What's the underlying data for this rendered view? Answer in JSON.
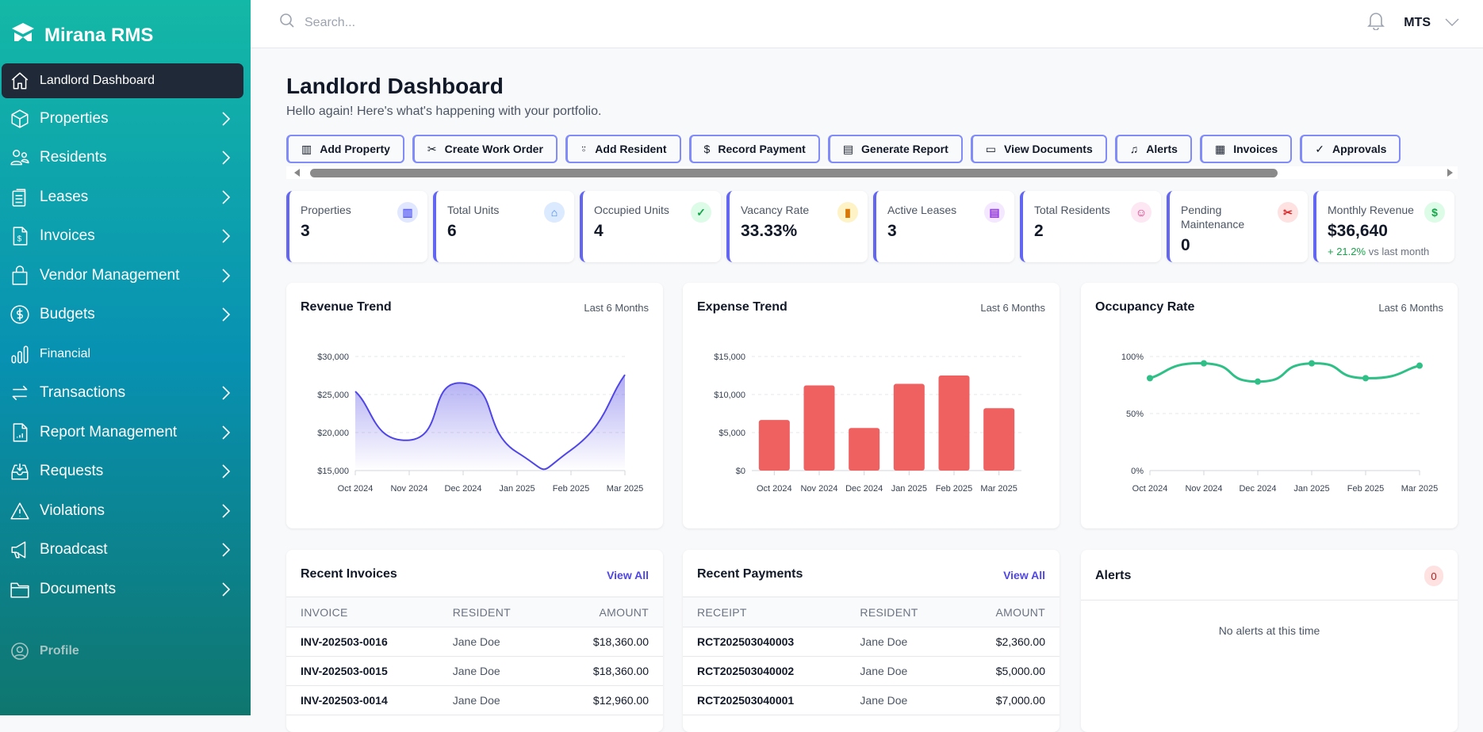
{
  "app": {
    "name": "Mirana RMS"
  },
  "sidebar": {
    "items": [
      {
        "label": "Landlord Dashboard",
        "icon": "home-icon",
        "active": true
      },
      {
        "label": "Properties",
        "icon": "cube-icon"
      },
      {
        "label": "Residents",
        "icon": "users-icon"
      },
      {
        "label": "Leases",
        "icon": "clipboard-icon"
      },
      {
        "label": "Invoices",
        "icon": "invoice-icon"
      },
      {
        "label": "Vendor Management",
        "icon": "shopping-bag-icon"
      },
      {
        "label": "Budgets",
        "icon": "dollar-circle-icon"
      },
      {
        "label": "Financial",
        "icon": "bar-chart-icon"
      },
      {
        "label": "Transactions",
        "icon": "arrows-icon"
      },
      {
        "label": "Report Management",
        "icon": "report-icon"
      },
      {
        "label": "Requests",
        "icon": "inbox-icon"
      },
      {
        "label": "Violations",
        "icon": "warning-icon"
      },
      {
        "label": "Broadcast",
        "icon": "megaphone-icon"
      },
      {
        "label": "Documents",
        "icon": "folder-icon"
      }
    ],
    "profile": "Profile"
  },
  "header": {
    "search_placeholder": "Search...",
    "user": "MTS"
  },
  "page": {
    "title": "Landlord Dashboard",
    "subtitle": "Hello again! Here's what's happening with your portfolio."
  },
  "actions": [
    "Add Property",
    "Create Work Order",
    "Add Resident",
    "Record Payment",
    "Generate Report",
    "View Documents",
    "Alerts",
    "Invoices",
    "Approvals"
  ],
  "stats": [
    {
      "label": "Properties",
      "value": "3",
      "color": "#6366f1",
      "bg": "#e0e7ff"
    },
    {
      "label": "Total Units",
      "value": "6",
      "color": "#3b82f6",
      "bg": "#dbeafe"
    },
    {
      "label": "Occupied Units",
      "value": "4",
      "color": "#16a34a",
      "bg": "#dcfce7"
    },
    {
      "label": "Vacancy Rate",
      "value": "33.33%",
      "color": "#d97706",
      "bg": "#fef3c7"
    },
    {
      "label": "Active Leases",
      "value": "3",
      "color": "#9333ea",
      "bg": "#f3e8ff"
    },
    {
      "label": "Total Residents",
      "value": "2",
      "color": "#db2777",
      "bg": "#fce7f3"
    },
    {
      "label": "Pending Maintenance",
      "value": "0",
      "color": "#dc2626",
      "bg": "#fee2e2"
    },
    {
      "label": "Monthly Revenue",
      "value": "$36,640",
      "color": "#16a34a",
      "bg": "#dcfce7",
      "trend": "+ 21.2%",
      "trend_text": "vs last month"
    }
  ],
  "chart_data": [
    {
      "type": "area",
      "title": "Revenue Trend",
      "subtitle": "Last 6 Months",
      "categories": [
        "Oct 2024",
        "Nov 2024",
        "Dec 2024",
        "Jan 2025",
        "Feb 2025",
        "Mar 2025"
      ],
      "values": [
        25400,
        19000,
        26500,
        17400,
        17700,
        27600
      ],
      "ylim": [
        15000,
        30000
      ],
      "yticks": [
        "$15,000",
        "$20,000",
        "$25,000",
        "$30,000"
      ],
      "color": "#4f46e5",
      "grid": true
    },
    {
      "type": "bar",
      "title": "Expense Trend",
      "subtitle": "Last 6 Months",
      "categories": [
        "Oct 2024",
        "Nov 2024",
        "Dec 2024",
        "Jan 2025",
        "Feb 2025",
        "Mar 2025"
      ],
      "values": [
        6650,
        11200,
        5600,
        11400,
        12500,
        8200
      ],
      "ylim": [
        0,
        15000
      ],
      "yticks": [
        "$0",
        "$5,000",
        "$10,000",
        "$15,000"
      ],
      "color": "#ef6060",
      "grid": true
    },
    {
      "type": "line",
      "title": "Occupancy Rate",
      "subtitle": "Last 6 Months",
      "categories": [
        "Oct 2024",
        "Nov 2024",
        "Dec 2024",
        "Jan 2025",
        "Feb 2025",
        "Mar 2025"
      ],
      "values": [
        81,
        94,
        78,
        94,
        81,
        92
      ],
      "ylim": [
        0,
        100
      ],
      "yticks": [
        "0%",
        "50%",
        "100%"
      ],
      "color": "#2fbf87",
      "grid": true
    }
  ],
  "invoices": {
    "title": "Recent Invoices",
    "view_all": "View All",
    "columns": [
      "INVOICE",
      "RESIDENT",
      "AMOUNT"
    ],
    "rows": [
      [
        "INV-202503-0016",
        "Jane Doe",
        "$18,360.00"
      ],
      [
        "INV-202503-0015",
        "Jane Doe",
        "$18,360.00"
      ],
      [
        "INV-202503-0014",
        "Jane Doe",
        "$12,960.00"
      ]
    ]
  },
  "payments": {
    "title": "Recent Payments",
    "view_all": "View All",
    "columns": [
      "RECEIPT",
      "RESIDENT",
      "AMOUNT"
    ],
    "rows": [
      [
        "RCT202503040003",
        "Jane Doe",
        "$2,360.00"
      ],
      [
        "RCT202503040002",
        "Jane Doe",
        "$5,000.00"
      ],
      [
        "RCT202503040001",
        "Jane Doe",
        "$7,000.00"
      ]
    ]
  },
  "alerts": {
    "title": "Alerts",
    "count": "0",
    "empty": "No alerts at this time"
  }
}
